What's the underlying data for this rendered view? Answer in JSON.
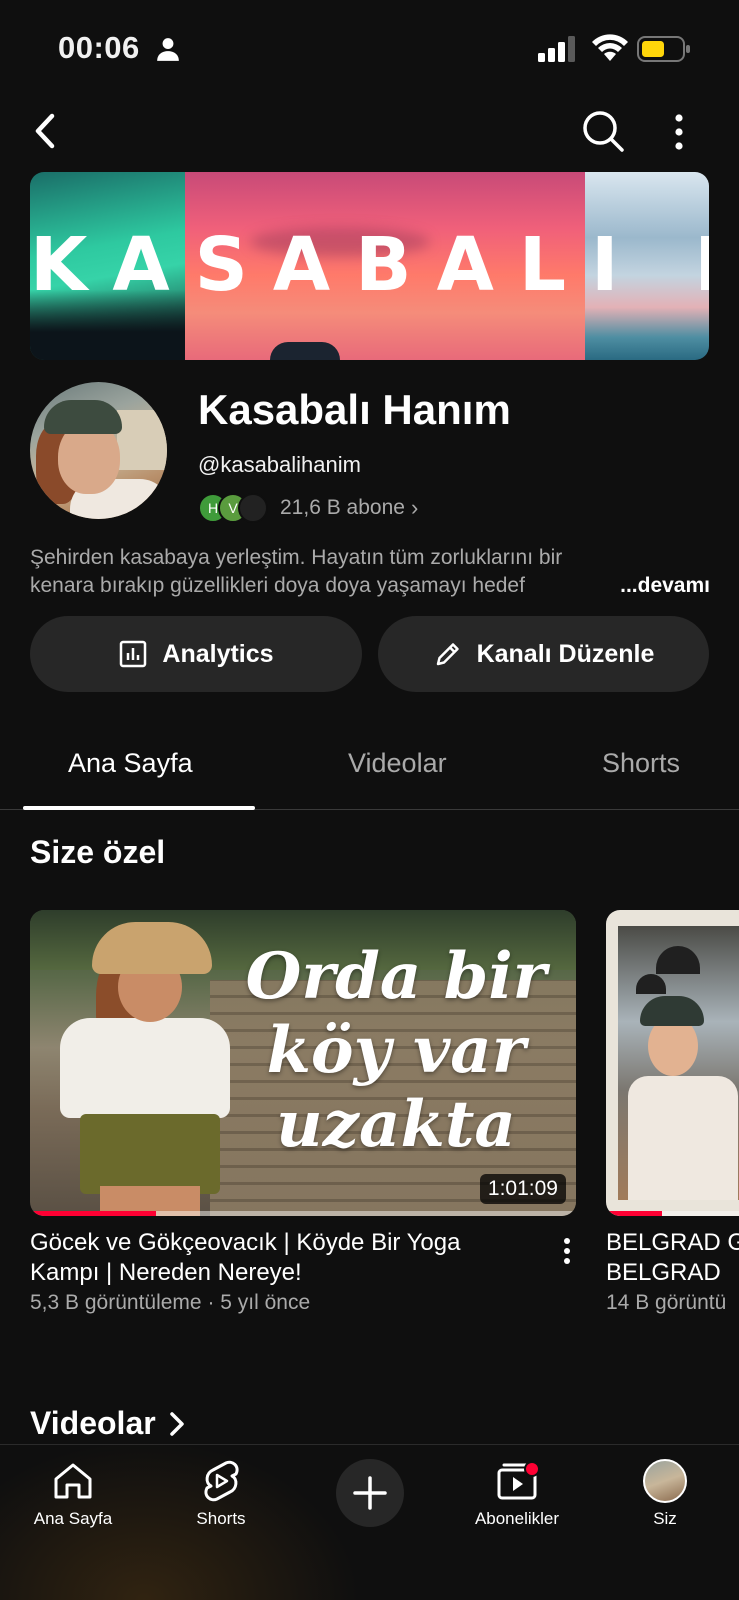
{
  "status_bar": {
    "time": "00:06"
  },
  "banner": {
    "title": "KASABALI HANIM"
  },
  "channel": {
    "name": "Kasabalı Hanım",
    "handle": "@kasabalihanim",
    "subscriber_avatars": [
      {
        "letter": "H",
        "color": "#3f9b3a"
      },
      {
        "letter": "V",
        "color": "#5a9c3e"
      },
      {
        "letter": "",
        "color": "#222222"
      }
    ],
    "subscribers": "21,6 B abone",
    "description_line1": "Şehirden kasabaya yerleştim. Hayatın tüm zorluklarını bir",
    "description_line2": "kenara bırakıp güzellikleri doya doya yaşamayı hedef",
    "description_more": "...devamı"
  },
  "actions": {
    "analytics_label": "Analytics",
    "edit_label": "Kanalı Düzenle"
  },
  "tabs": [
    {
      "label": "Ana Sayfa",
      "selected": true
    },
    {
      "label": "Videolar",
      "selected": false
    },
    {
      "label": "Shorts",
      "selected": false
    }
  ],
  "for_you": {
    "title": "Size özel",
    "videos": [
      {
        "thumb_text": "Orda bir köy var uzakta",
        "duration": "1:01:09",
        "watched_fraction": 0.23,
        "title": "Göcek ve Gökçeovacık | Köyde Bir Yoga Kampı | Nereden Nereye!",
        "meta": "5,3 B görüntüleme · 5 yıl önce"
      },
      {
        "title": "BELGRAD G BELGRAD",
        "title_line1": "BELGRAD G",
        "title_line2": "BELGRAD",
        "meta": "14 B görüntü",
        "watched_fraction": 0.35
      }
    ]
  },
  "videos_section": {
    "title": "Videolar"
  },
  "bottom_nav": [
    {
      "label": "Ana Sayfa",
      "icon": "home-icon"
    },
    {
      "label": "Shorts",
      "icon": "shorts-icon"
    },
    {
      "label": "",
      "icon": "create-icon"
    },
    {
      "label": "Abonelikler",
      "icon": "subscriptions-icon"
    },
    {
      "label": "Siz",
      "icon": "avatar"
    }
  ],
  "colors": {
    "background": "#0f0f0f",
    "surface": "#272727",
    "secondary_text": "#aaaaaa",
    "accent": "#ff0033"
  }
}
